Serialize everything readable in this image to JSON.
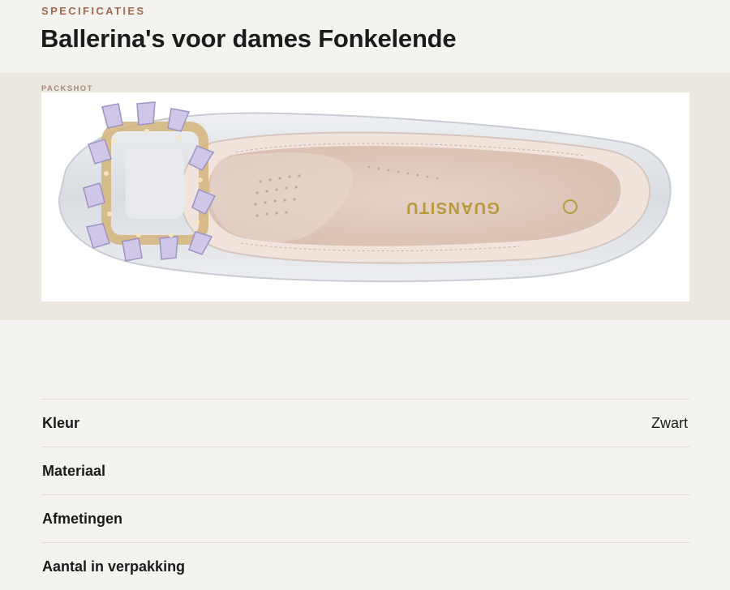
{
  "header": {
    "eyebrow": "SPECIFICATIES",
    "title": "Ballerina's voor dames Fonkelende"
  },
  "packshot": {
    "label": "PACKSHOT",
    "brand_text": "GUANSITU"
  },
  "specs": [
    {
      "label": "Kleur",
      "value": "Zwart"
    },
    {
      "label": "Materiaal",
      "value": ""
    },
    {
      "label": "Afmetingen",
      "value": ""
    },
    {
      "label": "Aantal in verpakking",
      "value": ""
    }
  ],
  "colors": {
    "accent": "#a06a4e",
    "background": "#f5f3ef",
    "band": "#ece8e0"
  }
}
